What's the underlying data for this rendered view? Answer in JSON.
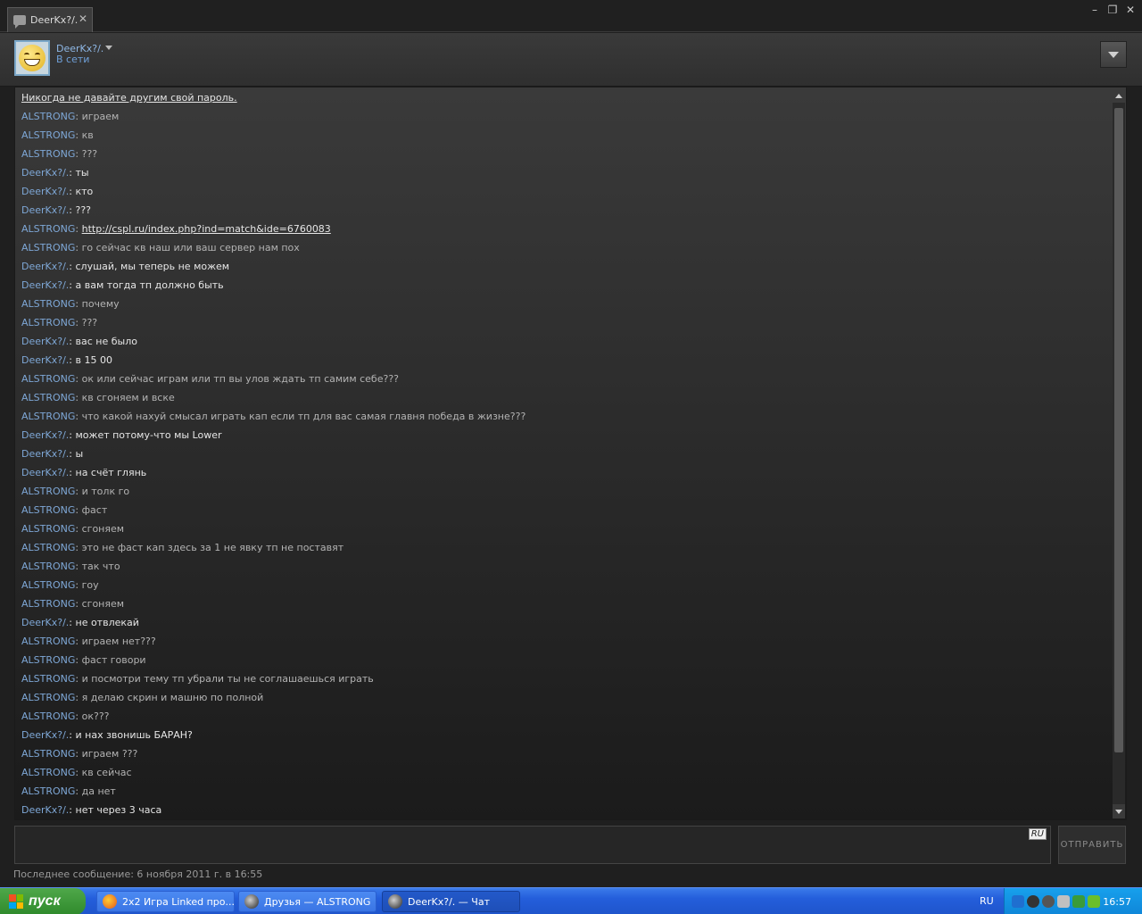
{
  "window": {
    "tab_title": "DeerKx?/.",
    "controls": [
      "–",
      "❐",
      "✕"
    ]
  },
  "header": {
    "username": "DeerKx?/.",
    "status": "В сети"
  },
  "chat": {
    "notice": "Никогда не давайте другим свой пароль.",
    "messages": [
      {
        "who": "ALSTRONG",
        "text": "играем",
        "side": "a"
      },
      {
        "who": "ALSTRONG",
        "text": "кв",
        "side": "a"
      },
      {
        "who": "ALSTRONG",
        "text": "???",
        "side": "a"
      },
      {
        "who": "DeerKx?/.",
        "text": "ты",
        "side": "d"
      },
      {
        "who": "DeerKx?/.",
        "text": "кто",
        "side": "d"
      },
      {
        "who": "DeerKx?/.",
        "text": "???",
        "side": "d"
      },
      {
        "who": "ALSTRONG",
        "text": "http://cspl.ru/index.php?ind=match&ide=6760083",
        "side": "a",
        "link": true
      },
      {
        "who": "ALSTRONG",
        "text": "го сейчас кв наш или ваш сервер нам пох",
        "side": "a"
      },
      {
        "who": "DeerKx?/.",
        "text": "слушай, мы теперь не можем",
        "side": "d"
      },
      {
        "who": "DeerKx?/.",
        "text": "а вам тогда тп должно быть",
        "side": "d"
      },
      {
        "who": "ALSTRONG",
        "text": "почему",
        "side": "a"
      },
      {
        "who": "ALSTRONG",
        "text": "???",
        "side": "a"
      },
      {
        "who": "DeerKx?/.",
        "text": "вас не было",
        "side": "d"
      },
      {
        "who": "DeerKx?/.",
        "text": "в 15 00",
        "side": "d"
      },
      {
        "who": "ALSTRONG",
        "text": "ок или сейчас играм или тп вы улов ждать тп самим себе???",
        "side": "a"
      },
      {
        "who": "ALSTRONG",
        "text": "кв сгоняем и вске",
        "side": "a"
      },
      {
        "who": "ALSTRONG",
        "text": "что какой нахуй смысал играть кап если тп для вас самая главня победа в жизне???",
        "side": "a"
      },
      {
        "who": "DeerKx?/.",
        "text": "может потому-что мы Lower",
        "side": "d"
      },
      {
        "who": "DeerKx?/.",
        "text": "ы",
        "side": "d"
      },
      {
        "who": "DeerKx?/.",
        "text": "на счёт глянь",
        "side": "d"
      },
      {
        "who": "ALSTRONG",
        "text": "и толк го",
        "side": "a"
      },
      {
        "who": "ALSTRONG",
        "text": "фаст",
        "side": "a"
      },
      {
        "who": "ALSTRONG",
        "text": "сгоняем",
        "side": "a"
      },
      {
        "who": "ALSTRONG",
        "text": "это не фаст кап здесь за 1 не явку тп не поставят",
        "side": "a"
      },
      {
        "who": "ALSTRONG",
        "text": "так что",
        "side": "a"
      },
      {
        "who": "ALSTRONG",
        "text": "гоу",
        "side": "a"
      },
      {
        "who": "ALSTRONG",
        "text": "сгоняем",
        "side": "a"
      },
      {
        "who": "DeerKx?/.",
        "text": "не отвлекай",
        "side": "d"
      },
      {
        "who": "ALSTRONG",
        "text": "играем нет???",
        "side": "a"
      },
      {
        "who": "ALSTRONG",
        "text": "фаст говори",
        "side": "a"
      },
      {
        "who": "ALSTRONG",
        "text": "и посмотри тему тп убрали ты не соглашаешься играть",
        "side": "a"
      },
      {
        "who": "ALSTRONG",
        "text": "я делаю скрин и машню по полной",
        "side": "a"
      },
      {
        "who": "ALSTRONG",
        "text": "ок???",
        "side": "a"
      },
      {
        "who": "DeerKx?/.",
        "text": "и нах звонишь БАРАН?",
        "side": "d"
      },
      {
        "who": "ALSTRONG",
        "text": "играем ???",
        "side": "a"
      },
      {
        "who": "ALSTRONG",
        "text": "кв сейчас",
        "side": "a"
      },
      {
        "who": "ALSTRONG",
        "text": "да нет",
        "side": "a"
      },
      {
        "who": "DeerKx?/.",
        "text": "нет через 3 часа",
        "side": "d"
      }
    ]
  },
  "input": {
    "lang_badge": "RU",
    "send_label": "ОТПРАВИТЬ"
  },
  "footer": {
    "last_message": "Последнее сообщение: 6 ноября 2011 г. в 16:55"
  },
  "taskbar": {
    "start_label": "пуск",
    "buttons": [
      {
        "label": "2x2 Игра Linked про...",
        "icon": "firefox-icon"
      },
      {
        "label": "Друзья — ALSTRONG",
        "icon": "steam-icon"
      },
      {
        "label": "DeerKx?/. — Чат",
        "icon": "steam-icon"
      }
    ],
    "lang": "RU",
    "clock": "16:57"
  }
}
